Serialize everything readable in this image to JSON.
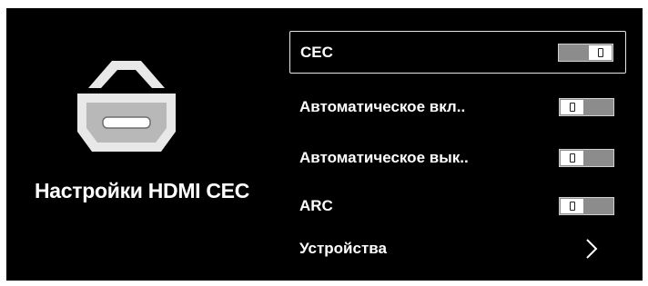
{
  "page": {
    "title": "Настройки HDMI CEC",
    "icon": "hdmi-icon"
  },
  "menu": {
    "items": [
      {
        "label": "CEC",
        "control": "toggle",
        "state": "on",
        "selected": true
      },
      {
        "label": "Автоматическое вкл..",
        "control": "toggle",
        "state": "off",
        "selected": false
      },
      {
        "label": "Автоматическое вык..",
        "control": "toggle",
        "state": "off",
        "selected": false
      },
      {
        "label": "ARC",
        "control": "toggle",
        "state": "off",
        "selected": false
      },
      {
        "label": "Устройства",
        "control": "chevron-right-icon",
        "selected": false
      }
    ]
  },
  "colors": {
    "background": "#000000",
    "text": "#ffffff",
    "toggle_track": "#8c8c8c",
    "selection_border": "#e6e6e6"
  }
}
